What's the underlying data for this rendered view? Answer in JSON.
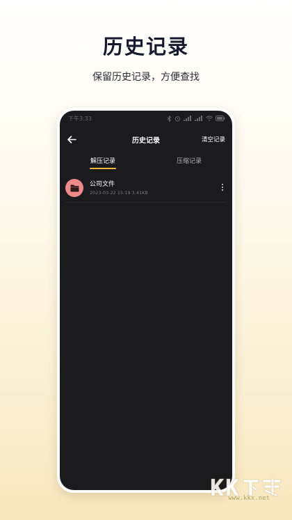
{
  "promo": {
    "title": "历史记录",
    "subtitle": "保留历史记录，方便查找"
  },
  "status_bar": {
    "time": "下午3:33",
    "icons": [
      "bluetooth-icon",
      "alarm-icon",
      "signal-icon",
      "signal-icon",
      "wifi-icon",
      "battery-icon"
    ]
  },
  "header": {
    "title": "历史记录",
    "clear_label": "清空记录",
    "back_icon": "arrow-left-icon"
  },
  "tabs": [
    {
      "label": "解压记录",
      "active": true
    },
    {
      "label": "压缩记录",
      "active": false
    }
  ],
  "accent_color": "#f0b93a",
  "files": [
    {
      "name": "公司文件",
      "meta": "2023-03-22 15:19  3.41KB",
      "icon": "folder-icon",
      "icon_bg": "#f08a8a"
    }
  ],
  "watermark": {
    "url": "www.kkx.net"
  }
}
